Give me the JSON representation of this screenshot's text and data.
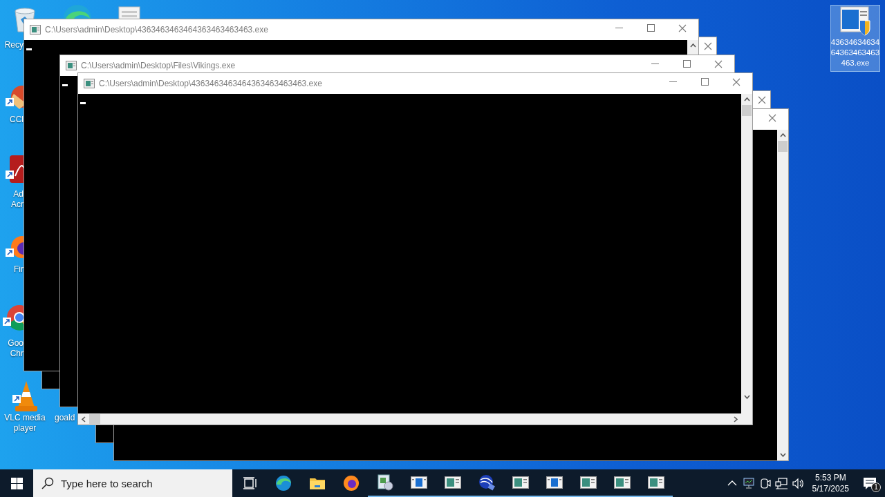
{
  "desktop_icons": [
    {
      "kind": "recycle",
      "label": "Recy"
    },
    {
      "kind": "edge"
    },
    {
      "kind": "document"
    },
    {
      "kind": "ccleaner",
      "label": "CCl"
    },
    {
      "kind": "acrobat",
      "label": "Ad Acr"
    },
    {
      "kind": "firefox",
      "label": "Fir"
    },
    {
      "kind": "chrome",
      "label": "Goo Chr"
    },
    {
      "kind": "vlc",
      "label": "VLC media player"
    },
    {
      "kind": "hidden",
      "label": "goald"
    },
    {
      "kind": "exe",
      "label": "4363463463464363463463463.exe",
      "selected": true
    }
  ],
  "windows": [
    {
      "kind": "titled_top_scroll",
      "title": "C:\\Users\\admin\\Desktop\\4363463463464363463463463.exe"
    },
    {
      "kind": "close_only"
    },
    {
      "kind": "titled",
      "title": "C:\\Users\\admin\\Desktop\\Files\\Vikings.exe"
    },
    {
      "kind": "front",
      "title": "C:\\Users\\admin\\Desktop\\4363463463464363463463463.exe"
    },
    {
      "kind": "close_only"
    },
    {
      "kind": "close_scroll"
    }
  ],
  "taskbar": {
    "search": {
      "placeholder": "Type here to search"
    },
    "items": [
      {
        "kind": "task_view",
        "running": false
      },
      {
        "kind": "edge",
        "running": false
      },
      {
        "kind": "explorer",
        "running": false
      },
      {
        "kind": "firefox",
        "running": false
      },
      {
        "kind": "installer",
        "running": true
      },
      {
        "kind": "console_blue",
        "running": true
      },
      {
        "kind": "console",
        "running": true
      },
      {
        "kind": "logo",
        "running": true
      },
      {
        "kind": "console",
        "running": true
      },
      {
        "kind": "console_blue",
        "running": true
      },
      {
        "kind": "console",
        "running": true
      },
      {
        "kind": "console",
        "running": true
      },
      {
        "kind": "console",
        "running": true
      }
    ],
    "clock": {
      "time": "5:53 PM",
      "date": "5/17/2025"
    },
    "notifications": {
      "count": "1"
    }
  }
}
